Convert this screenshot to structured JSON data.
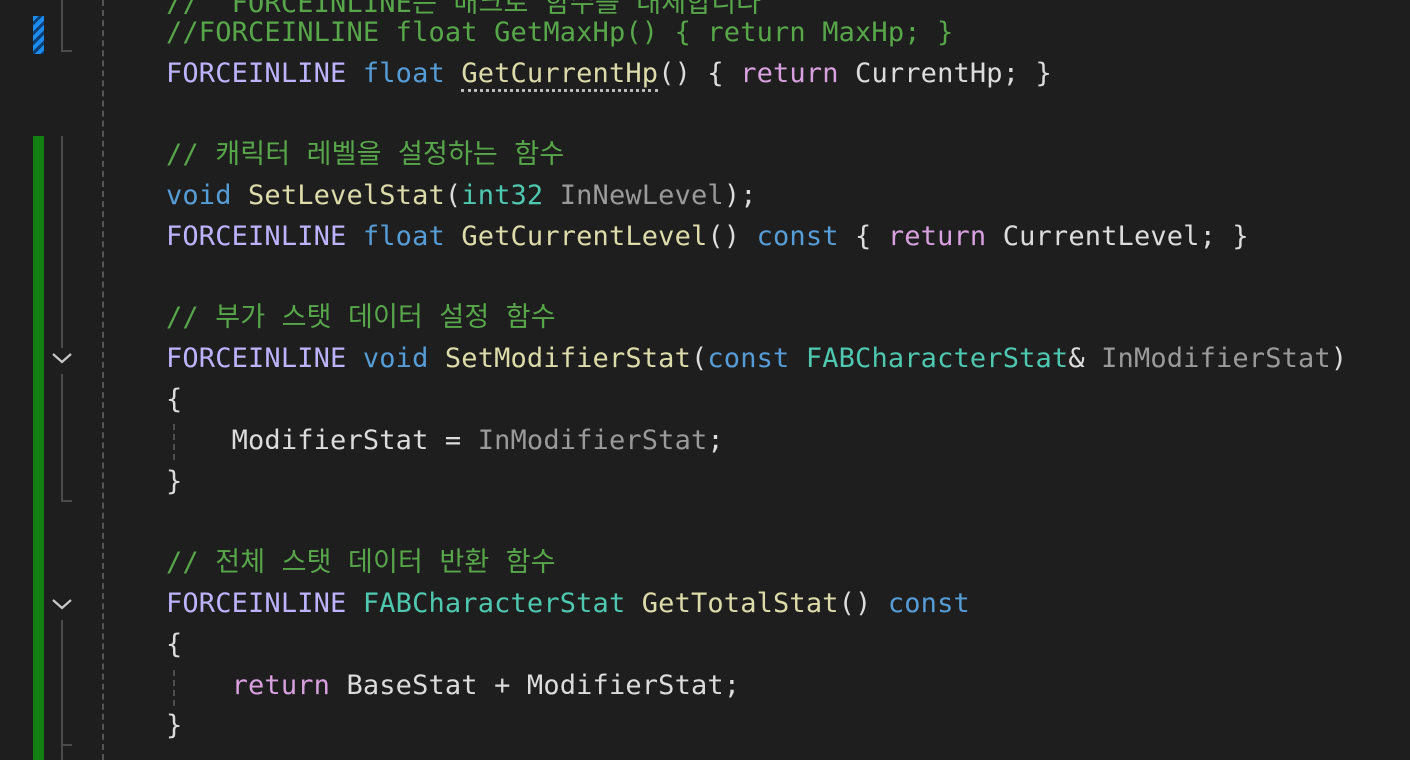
{
  "editor": {
    "colors": {
      "background": "#1e1e1e",
      "comment": "#57a64a",
      "keyword": "#569cd6",
      "control": "#d8a0df",
      "function": "#dcdcaa",
      "type": "#4ec9b0",
      "parameter": "#9a9a9a",
      "macro": "#bdb3ff",
      "change_saved": "#137f13",
      "change_unsaved": "#1c8cf0"
    },
    "gutter": {
      "fold_icons": [
        "chevron-down-icon",
        "chevron-down-icon"
      ]
    },
    "lines": [
      {
        "tokens": [
          {
            "t": "//__FORCEINLINE는 매크로 함수를 대체합니다",
            "c": "comment"
          }
        ]
      },
      {
        "tokens": [
          {
            "t": "//FORCEINLINE float GetMaxHp() { return MaxHp; }",
            "c": "comment"
          }
        ]
      },
      {
        "tokens": [
          {
            "t": "FORCEINLINE",
            "c": "macro"
          },
          {
            "t": " ",
            "c": "plain"
          },
          {
            "t": "float",
            "c": "kw"
          },
          {
            "t": " ",
            "c": "plain"
          },
          {
            "t": "GetCurrentHp",
            "c": "fn"
          },
          {
            "t": "() { ",
            "c": "plain"
          },
          {
            "t": "return",
            "c": "ctl"
          },
          {
            "t": " CurrentHp; }",
            "c": "plain"
          }
        ]
      },
      {
        "tokens": []
      },
      {
        "tokens": [
          {
            "t": "// 캐릭터 레벨을 설정하는 함수",
            "c": "comment"
          }
        ]
      },
      {
        "tokens": [
          {
            "t": "void",
            "c": "kw"
          },
          {
            "t": " ",
            "c": "plain"
          },
          {
            "t": "SetLevelStat",
            "c": "fn"
          },
          {
            "t": "(",
            "c": "plain"
          },
          {
            "t": "int32",
            "c": "type"
          },
          {
            "t": " ",
            "c": "plain"
          },
          {
            "t": "InNewLevel",
            "c": "param"
          },
          {
            "t": ");",
            "c": "plain"
          }
        ]
      },
      {
        "tokens": [
          {
            "t": "FORCEINLINE",
            "c": "macro"
          },
          {
            "t": " ",
            "c": "plain"
          },
          {
            "t": "float",
            "c": "kw"
          },
          {
            "t": " ",
            "c": "plain"
          },
          {
            "t": "GetCurrentLevel",
            "c": "fn"
          },
          {
            "t": "() ",
            "c": "plain"
          },
          {
            "t": "const",
            "c": "kw"
          },
          {
            "t": " { ",
            "c": "plain"
          },
          {
            "t": "return",
            "c": "ctl"
          },
          {
            "t": " CurrentLevel; }",
            "c": "plain"
          }
        ]
      },
      {
        "tokens": []
      },
      {
        "tokens": [
          {
            "t": "// 부가 스탯 데이터 설정 함수",
            "c": "comment"
          }
        ]
      },
      {
        "tokens": [
          {
            "t": "FORCEINLINE",
            "c": "macro"
          },
          {
            "t": " ",
            "c": "plain"
          },
          {
            "t": "void",
            "c": "kw"
          },
          {
            "t": " ",
            "c": "plain"
          },
          {
            "t": "SetModifierStat",
            "c": "fn"
          },
          {
            "t": "(",
            "c": "plain"
          },
          {
            "t": "const",
            "c": "kw"
          },
          {
            "t": " ",
            "c": "plain"
          },
          {
            "t": "FABCharacterStat",
            "c": "type"
          },
          {
            "t": "& ",
            "c": "plain"
          },
          {
            "t": "InModifierStat",
            "c": "param"
          },
          {
            "t": ")",
            "c": "plain"
          }
        ]
      },
      {
        "tokens": [
          {
            "t": "{",
            "c": "plain"
          }
        ]
      },
      {
        "tokens": [
          {
            "t": "    ModifierStat = ",
            "c": "plain"
          },
          {
            "t": "InModifierStat",
            "c": "param"
          },
          {
            "t": ";",
            "c": "plain"
          }
        ]
      },
      {
        "tokens": [
          {
            "t": "}",
            "c": "plain"
          }
        ]
      },
      {
        "tokens": []
      },
      {
        "tokens": [
          {
            "t": "// 전체 스탯 데이터 반환 함수",
            "c": "comment"
          }
        ]
      },
      {
        "tokens": [
          {
            "t": "FORCEINLINE",
            "c": "macro"
          },
          {
            "t": " ",
            "c": "plain"
          },
          {
            "t": "FABCharacterStat",
            "c": "type"
          },
          {
            "t": " ",
            "c": "plain"
          },
          {
            "t": "GetTotalStat",
            "c": "fn"
          },
          {
            "t": "() ",
            "c": "plain"
          },
          {
            "t": "const",
            "c": "kw"
          }
        ]
      },
      {
        "tokens": [
          {
            "t": "{",
            "c": "plain"
          }
        ]
      },
      {
        "tokens": [
          {
            "t": "    ",
            "c": "plain"
          },
          {
            "t": "return",
            "c": "ctl"
          },
          {
            "t": " BaseStat + ModifierStat;",
            "c": "plain"
          }
        ]
      },
      {
        "tokens": [
          {
            "t": "}",
            "c": "plain"
          }
        ]
      }
    ]
  }
}
